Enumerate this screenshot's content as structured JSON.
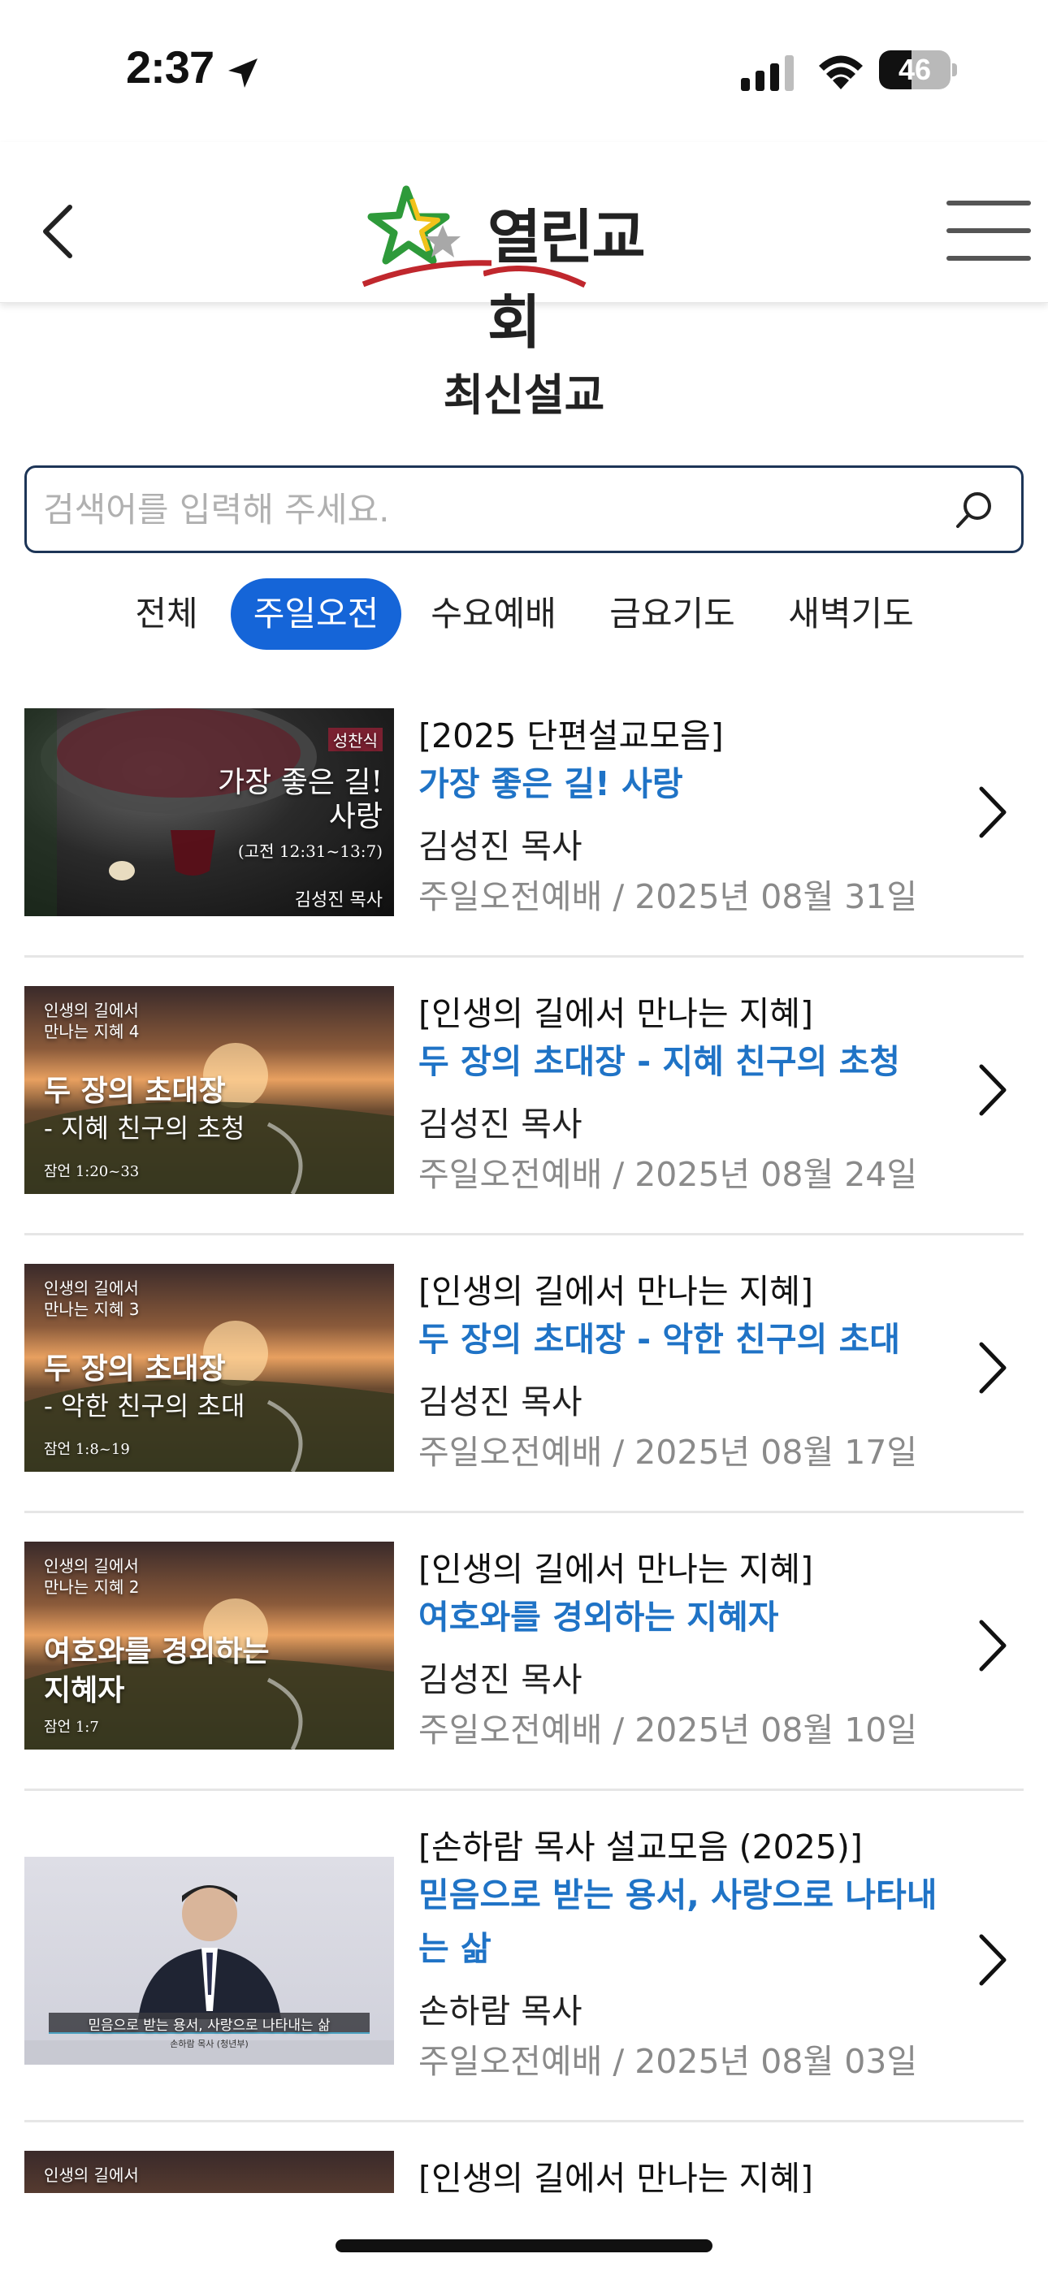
{
  "status_bar": {
    "time": "2:37",
    "battery": "46"
  },
  "header": {
    "logo_text": "열린교회"
  },
  "page": {
    "title": "최신설교"
  },
  "search": {
    "placeholder": "검색어를 입력해 주세요."
  },
  "tabs": [
    {
      "label": "전체",
      "active": false
    },
    {
      "label": "주일오전",
      "active": true
    },
    {
      "label": "수요예배",
      "active": false
    },
    {
      "label": "금요기도",
      "active": false
    },
    {
      "label": "새벽기도",
      "active": false
    }
  ],
  "sermons": [
    {
      "series": "[2025 단편설교모음]",
      "title": "가장 좋은 길! 사랑",
      "pastor": "김성진 목사",
      "date": "주일오전예배 / 2025년 08월 31일",
      "thumb": {
        "tag": "성찬식",
        "line1": "가장 좋은 길!",
        "line2": "사랑",
        "ref": "(고전 12:31~13:7)",
        "name": "김성진 목사"
      }
    },
    {
      "series": "[인생의 길에서 만나는 지혜]",
      "title": "두 장의 초대장 - 지혜 친구의 초청",
      "pastor": "김성진 목사",
      "date": "주일오전예배 / 2025년 08월 24일",
      "thumb": {
        "small1": "인생의 길에서",
        "small2": "만나는 지혜 4",
        "main1": "두 장의 초대장",
        "main2": "- 지혜 친구의 초청",
        "ref": "잠언 1:20~33"
      }
    },
    {
      "series": "[인생의 길에서 만나는 지혜]",
      "title": "두 장의 초대장 - 악한 친구의 초대",
      "pastor": "김성진 목사",
      "date": "주일오전예배 / 2025년 08월 17일",
      "thumb": {
        "small1": "인생의 길에서",
        "small2": "만나는 지혜 3",
        "main1": "두 장의 초대장",
        "main2": "- 악한 친구의 초대",
        "ref": "잠언 1:8~19"
      }
    },
    {
      "series": "[인생의 길에서 만나는 지혜]",
      "title": "여호와를 경외하는 지혜자",
      "pastor": "김성진 목사",
      "date": "주일오전예배 / 2025년 08월 10일",
      "thumb": {
        "small1": "인생의 길에서",
        "small2": "만나는 지혜 2",
        "main1": "여호와를 경외하는",
        "main2": "지혜자",
        "ref": "잠언 1:7"
      }
    },
    {
      "series": "[손하람 목사 설교모음 (2025)]",
      "title": "믿음으로 받는 용서, 사랑으로 나타내는 삶",
      "pastor": "손하람 목사",
      "date": "주일오전예배 / 2025년 08월 03일",
      "thumb": {
        "subtitle": "믿음으로 받는 용서, 사랑으로 나타내는 삶",
        "name": "손하람 목사 (청년부)"
      }
    },
    {
      "series": "[인생의 길에서 만나는 지혜]",
      "thumb": {
        "small1": "인생의 길에서"
      }
    }
  ]
}
